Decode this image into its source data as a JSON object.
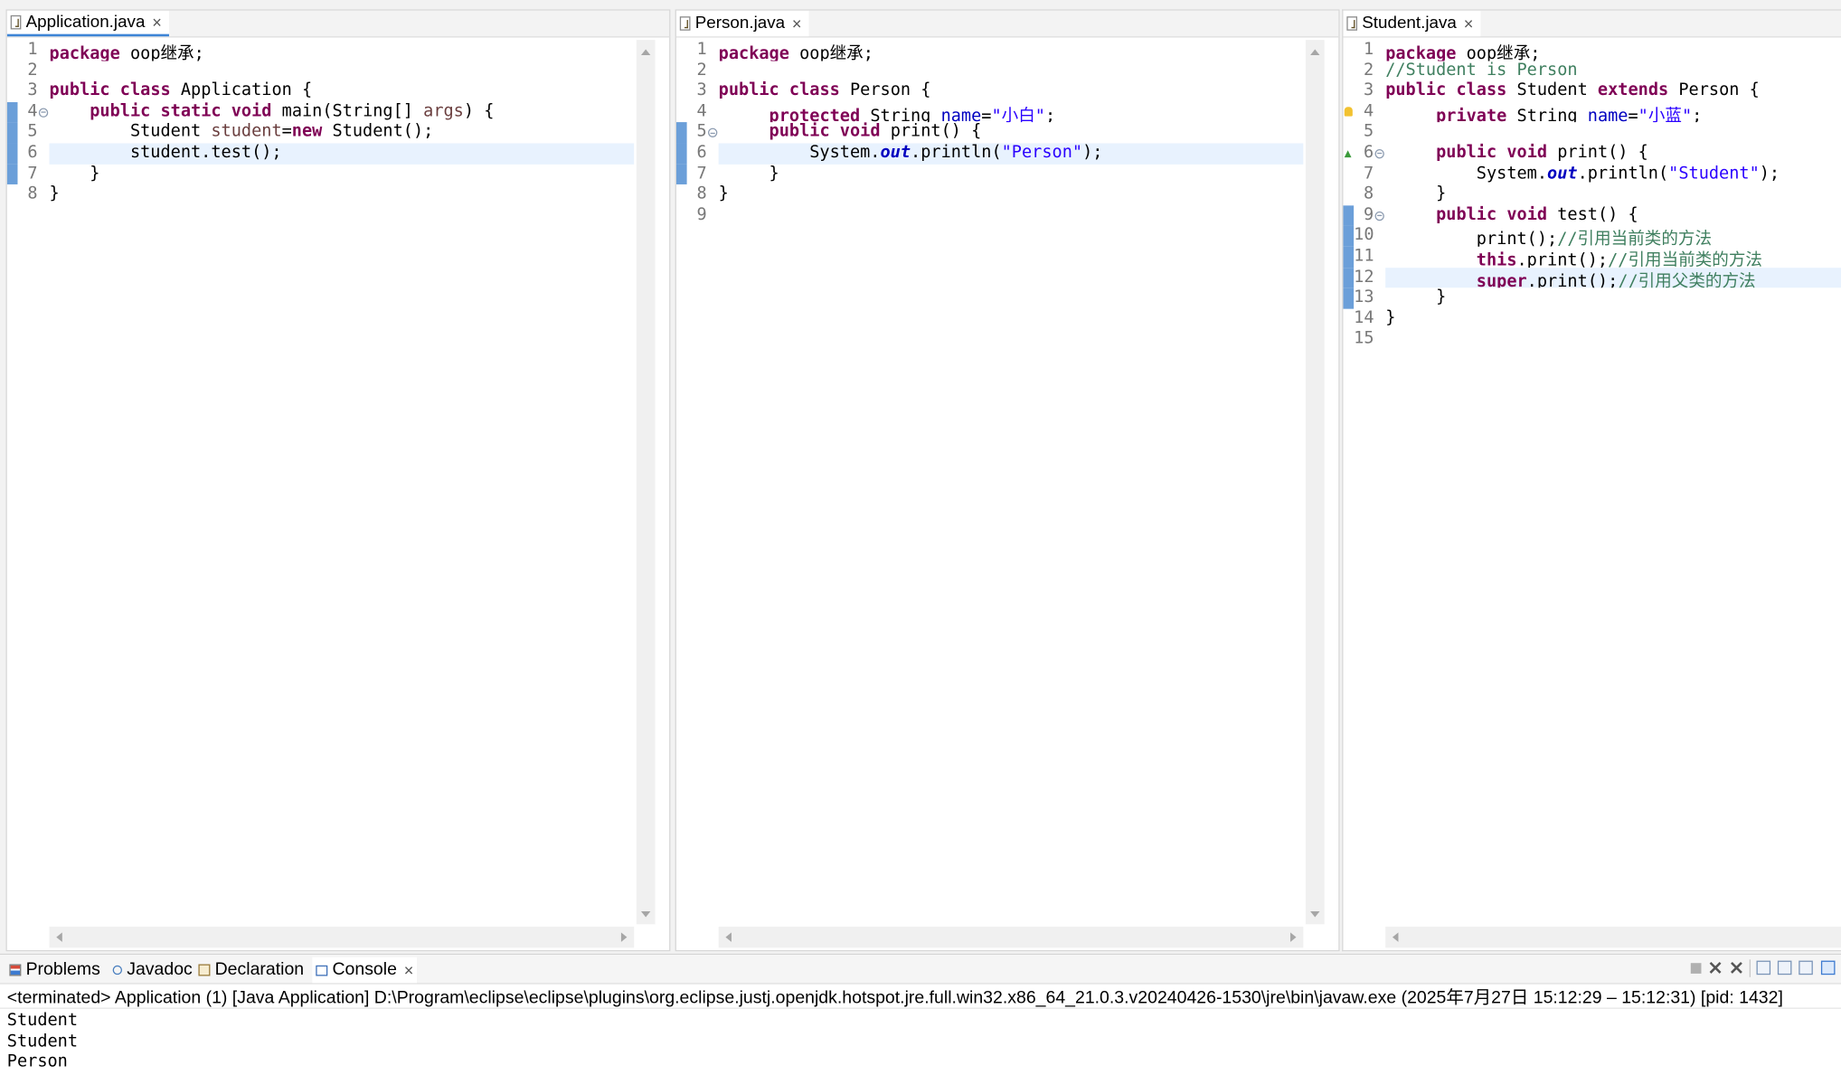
{
  "editors": [
    {
      "tab": {
        "label": "Application.java",
        "close": "×",
        "icon": "java-file-icon"
      },
      "focused": true,
      "current_line": "6",
      "lines": [
        {
          "n": "1",
          "segs": [
            [
              "package",
              "kw"
            ],
            [
              " oop继承;",
              ""
            ]
          ]
        },
        {
          "n": "2",
          "segs": []
        },
        {
          "n": "3",
          "segs": [
            [
              "public",
              "kw"
            ],
            [
              " ",
              ""
            ],
            [
              "class",
              "kw"
            ],
            [
              " Application {",
              ""
            ]
          ]
        },
        {
          "n": "4",
          "fold": true,
          "changed": true,
          "segs": [
            [
              "    ",
              ""
            ],
            [
              "public",
              "kw"
            ],
            [
              " ",
              ""
            ],
            [
              "static",
              "kw"
            ],
            [
              " ",
              ""
            ],
            [
              "void",
              "kw"
            ],
            [
              " main(String[] ",
              ""
            ],
            [
              "args",
              "loc"
            ],
            [
              ") {",
              ""
            ]
          ]
        },
        {
          "n": "5",
          "changed": true,
          "segs": [
            [
              "        Student ",
              ""
            ],
            [
              "student",
              "loc"
            ],
            [
              "=",
              ""
            ],
            [
              "new",
              "kw"
            ],
            [
              " Student();",
              ""
            ]
          ]
        },
        {
          "n": "6",
          "changed": true,
          "segs": [
            [
              "        student.test();",
              ""
            ]
          ]
        },
        {
          "n": "7",
          "changed": true,
          "segs": [
            [
              "    }",
              ""
            ]
          ]
        },
        {
          "n": "8",
          "segs": [
            [
              "}",
              ""
            ]
          ]
        }
      ]
    },
    {
      "tab": {
        "label": "Person.java",
        "close": "×",
        "icon": "java-file-icon"
      },
      "focused": false,
      "current_line": "6",
      "lines": [
        {
          "n": "1",
          "segs": [
            [
              "package",
              "kw"
            ],
            [
              " oop继承;",
              ""
            ]
          ]
        },
        {
          "n": "2",
          "segs": []
        },
        {
          "n": "3",
          "segs": [
            [
              "public",
              "kw"
            ],
            [
              " ",
              ""
            ],
            [
              "class",
              "kw"
            ],
            [
              " Person {",
              ""
            ]
          ]
        },
        {
          "n": "4",
          "segs": [
            [
              "     ",
              ""
            ],
            [
              "protected",
              "kw"
            ],
            [
              " String ",
              ""
            ],
            [
              "name",
              "fld"
            ],
            [
              "=",
              ""
            ],
            [
              "\"小白\"",
              "str"
            ],
            [
              ";",
              ""
            ]
          ]
        },
        {
          "n": "5",
          "fold": true,
          "changed": true,
          "segs": [
            [
              "     ",
              ""
            ],
            [
              "public",
              "kw"
            ],
            [
              " ",
              ""
            ],
            [
              "void",
              "kw"
            ],
            [
              " print() {",
              ""
            ]
          ]
        },
        {
          "n": "6",
          "changed": true,
          "segs": [
            [
              "         System.",
              ""
            ],
            [
              "out",
              "sfld"
            ],
            [
              ".println(",
              ""
            ],
            [
              "\"Person\"",
              "str"
            ],
            [
              ");",
              ""
            ]
          ]
        },
        {
          "n": "7",
          "changed": true,
          "segs": [
            [
              "     }",
              ""
            ]
          ]
        },
        {
          "n": "8",
          "segs": [
            [
              "}",
              ""
            ]
          ]
        },
        {
          "n": "9",
          "segs": []
        }
      ]
    },
    {
      "tab": {
        "label": "Student.java",
        "close": "×",
        "icon": "java-file-icon"
      },
      "focused": false,
      "current_line": "12",
      "lines": [
        {
          "n": "1",
          "segs": [
            [
              "package",
              "kw"
            ],
            [
              " oop继承;",
              ""
            ]
          ]
        },
        {
          "n": "2",
          "segs": [
            [
              "//Student is Person",
              "cm"
            ]
          ]
        },
        {
          "n": "3",
          "segs": [
            [
              "public",
              "kw"
            ],
            [
              " ",
              ""
            ],
            [
              "class",
              "kw"
            ],
            [
              " Student ",
              ""
            ],
            [
              "extends",
              "kw"
            ],
            [
              " Person {",
              ""
            ]
          ]
        },
        {
          "n": "4",
          "ann": "warning-icon",
          "segs": [
            [
              "     ",
              ""
            ],
            [
              "private",
              "kw"
            ],
            [
              " String ",
              ""
            ],
            [
              "name",
              "fld warn"
            ],
            [
              "=",
              ""
            ],
            [
              "\"小蓝\"",
              "str"
            ],
            [
              ";",
              ""
            ]
          ]
        },
        {
          "n": "5",
          "segs": []
        },
        {
          "n": "6",
          "fold": true,
          "ann": "override-icon",
          "segs": [
            [
              "     ",
              ""
            ],
            [
              "public",
              "kw"
            ],
            [
              " ",
              ""
            ],
            [
              "void",
              "kw"
            ],
            [
              " print() {",
              ""
            ]
          ]
        },
        {
          "n": "7",
          "segs": [
            [
              "         System.",
              ""
            ],
            [
              "out",
              "sfld"
            ],
            [
              ".println(",
              ""
            ],
            [
              "\"Student\"",
              "str"
            ],
            [
              ");",
              ""
            ]
          ]
        },
        {
          "n": "8",
          "segs": [
            [
              "     }",
              ""
            ]
          ]
        },
        {
          "n": "9",
          "fold": true,
          "changed": true,
          "segs": [
            [
              "     ",
              ""
            ],
            [
              "public",
              "kw"
            ],
            [
              " ",
              ""
            ],
            [
              "void",
              "kw"
            ],
            [
              " test() {",
              ""
            ]
          ]
        },
        {
          "n": "10",
          "changed": true,
          "segs": [
            [
              "         print();",
              ""
            ],
            [
              "//引用当前类的方法",
              "cm"
            ]
          ]
        },
        {
          "n": "11",
          "changed": true,
          "segs": [
            [
              "         ",
              ""
            ],
            [
              "this",
              "kw"
            ],
            [
              ".print();",
              ""
            ],
            [
              "//引用当前类的方法",
              "cm"
            ]
          ]
        },
        {
          "n": "12",
          "changed": true,
          "segs": [
            [
              "         ",
              ""
            ],
            [
              "super",
              "kw"
            ],
            [
              ".print();",
              ""
            ],
            [
              "//引用父类的方法",
              "cm"
            ]
          ]
        },
        {
          "n": "13",
          "changed": true,
          "segs": [
            [
              "     }",
              ""
            ]
          ]
        },
        {
          "n": "14",
          "segs": [
            [
              "}",
              ""
            ]
          ]
        },
        {
          "n": "15",
          "segs": []
        }
      ]
    }
  ],
  "bottom_panel": {
    "tabs": [
      {
        "label": "Problems",
        "icon": "problems-icon"
      },
      {
        "label": "Javadoc",
        "icon": "javadoc-icon"
      },
      {
        "label": "Declaration",
        "icon": "declaration-icon"
      },
      {
        "label": "Console",
        "icon": "console-icon",
        "close": "×",
        "active": true
      }
    ],
    "toolbar_icons": [
      "terminate-icon",
      "remove-launch-icon",
      "remove-all-terminated-icon",
      "scroll-lock-icon",
      "word-wrap-icon",
      "pin-console-icon",
      "open-console-icon"
    ],
    "console": {
      "header": "<terminated> Application (1) [Java Application] D:\\Program\\eclipse\\eclipse\\plugins\\org.eclipse.justj.openjdk.hotspot.jre.full.win32.x86_64_21.0.3.v20240426-1530\\jre\\bin\\javaw.exe  (2025年7月27日 15:12:29 – 15:12:31) [pid: 1432]",
      "output": [
        "Student",
        "Student",
        "Person"
      ]
    }
  },
  "colors": {
    "keyword": "#7f0055",
    "string": "#2a00ff",
    "comment": "#3f7f5f",
    "field": "#0000c0",
    "local_variable": "#6a3e3e",
    "current_line_highlight": "#e8f2fe",
    "change_ruler": "#6b9fd9"
  }
}
